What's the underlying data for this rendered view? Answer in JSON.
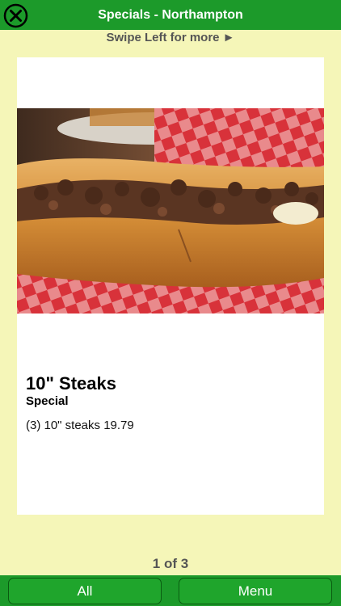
{
  "header": {
    "title": "Specials - Northampton",
    "close_icon": "close-circle-x-icon"
  },
  "swipe_hint": "Swipe Left for more ►",
  "item": {
    "title": "10\" Steaks",
    "subtitle": "Special",
    "description": "(3) 10\" steaks 19.79",
    "photo": "cheesesteak-sandwich-photo"
  },
  "pager": "1 of 3",
  "footer": {
    "all_label": "All",
    "menu_label": "Menu"
  },
  "colors": {
    "bar_green": "#1c9a2a",
    "background": "#f5f6b8",
    "card": "#ffffff"
  }
}
